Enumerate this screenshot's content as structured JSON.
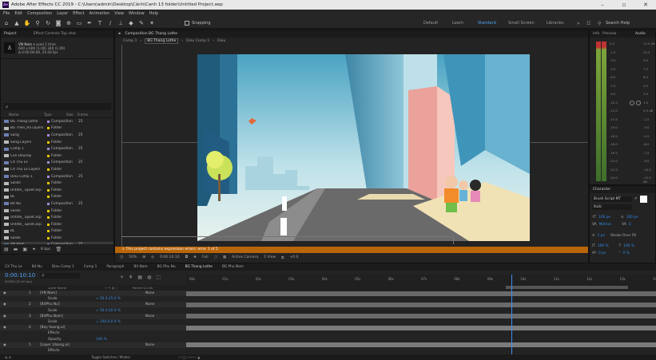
{
  "title_bar": {
    "app_logo": "Ae",
    "title": "Adobe After Effects CC 2019 - C:\\Users\\admin\\Desktop\\Cảnh\\Canh 13 folder\\Untitled Project.aep"
  },
  "menu": [
    "File",
    "Edit",
    "Composition",
    "Layer",
    "Effect",
    "Animation",
    "View",
    "Window",
    "Help"
  ],
  "toolbar": {
    "snapping": "Snapping",
    "workspaces": [
      "Default",
      "Learn",
      "Standard",
      "Small Screen",
      "Libraries"
    ],
    "active_workspace": "Standard",
    "search_placeholder": "Search Help"
  },
  "project_panel": {
    "tab": "Project",
    "tab2": "Effect Controls Top shot",
    "selected_item": "VN Nam",
    "selected_info": "used 1 time",
    "selected_size": "600 x 600 (1.00) 340 (1.00)",
    "selected_dur": "Δ 0:00:00:00, 25.00 fps",
    "search_placeholder": "ρ",
    "columns": [
      "Name",
      "Type",
      "Size",
      "Frame"
    ],
    "items": [
      {
        "name": "BG Thang Lothe",
        "type": "Composition",
        "rate": "25",
        "color": "#a58bd6",
        "icon": "comp"
      },
      {
        "name": "BG Then_Ra Layers",
        "type": "Folder",
        "rate": "",
        "color": "#e6c500",
        "icon": "folder"
      },
      {
        "name": "Song",
        "type": "Composition",
        "rate": "25",
        "color": "#a58bd6",
        "icon": "comp"
      },
      {
        "name": "Song Layers",
        "type": "Folder",
        "rate": "",
        "color": "#e6c500",
        "icon": "folder"
      },
      {
        "name": "Comp 1",
        "type": "Composition",
        "rate": "25",
        "color": "#a58bd6",
        "icon": "comp"
      },
      {
        "name": "Con Daunay",
        "type": "Folder",
        "rate": "",
        "color": "#e6c500",
        "icon": "folder"
      },
      {
        "name": "CX Thu Le",
        "type": "Composition",
        "rate": "25",
        "color": "#a58bd6",
        "icon": "comp"
      },
      {
        "name": "CX Thu Le Layers",
        "type": "Folder",
        "rate": "",
        "color": "#e6c500",
        "icon": "folder"
      },
      {
        "name": "Dieu Comp 1",
        "type": "Composition",
        "rate": "25",
        "color": "#a58bd6",
        "icon": "comp"
      },
      {
        "name": "Solids",
        "type": "Folder",
        "rate": "",
        "color": "#e6c500",
        "icon": "folder"
      },
      {
        "name": "Untitle_ upset.acp",
        "type": "Folder",
        "rate": "",
        "color": "#e6c500",
        "icon": "folder"
      },
      {
        "name": "BL",
        "type": "Folder",
        "rate": "",
        "color": "#e6c500",
        "icon": "folder"
      },
      {
        "name": "Bit Nu",
        "type": "Composition",
        "rate": "25",
        "color": "#a58bd6",
        "icon": "comp"
      },
      {
        "name": "Solids",
        "type": "Folder",
        "rate": "",
        "color": "#e6c500",
        "icon": "folder"
      },
      {
        "name": "Untitle_ upset.acp",
        "type": "Folder",
        "rate": "",
        "color": "#e6c500",
        "icon": "folder"
      },
      {
        "name": "Untitle_ upset.acp",
        "type": "Folder",
        "rate": "",
        "color": "#e6c500",
        "icon": "folder"
      },
      {
        "name": "BL",
        "type": "Folder",
        "rate": "",
        "color": "#e6c500",
        "icon": "folder"
      },
      {
        "name": "Solids",
        "type": "Folder",
        "rate": "",
        "color": "#e6c500",
        "icon": "folder"
      },
      {
        "name": "VN Nam",
        "type": "Composition",
        "rate": "25",
        "color": "#a58bd6",
        "icon": "comp"
      }
    ],
    "bpc": "8 bpc"
  },
  "composition": {
    "tab": "Composition BG Thang Lothe",
    "tabs": [
      "Comp 1",
      "BG Thang Lothe",
      "Dieu Comp 1",
      "Dieu"
    ],
    "active_tab": "BG Thang Lothe",
    "warning": "This project contains expression errors: error 1 of 5",
    "zoom": "50%",
    "timecode": "0:00:10:10",
    "resolution": "Full",
    "camera": "Active Camera",
    "view": "1 View",
    "offset": "+0.0"
  },
  "right_panel": {
    "tabs": [
      "Info",
      "Preview",
      "Audio"
    ],
    "active_tab": "Audio",
    "db_ticks_left": [
      "0.0",
      "-1.5",
      "-3.0",
      "-4.5",
      "-6.0",
      "-7.5",
      "-9.0",
      "-10.5",
      "-12.0",
      "-13.5",
      "-15.0",
      "-16.5",
      "-18.0",
      "-19.5",
      "-21.0",
      "-22.5",
      "-24.0"
    ],
    "db_ticks_right": [
      "12.0 dB",
      "10.5",
      "9.0",
      "7.5",
      "6.0",
      "4.5",
      "3.0",
      "1.5",
      "0.0 dB",
      "-1.5",
      "-3.0",
      "-4.5",
      "-6.0",
      "-7.5",
      "-9.0",
      "-10.5",
      "-12.0 dB"
    ],
    "character": {
      "tab": "Character",
      "font": "Brush Script MT",
      "style": "Italic",
      "size": "100 px",
      "leading": "100 px",
      "kerning": "Metrics",
      "tracking": "0",
      "stroke_width": "1 px",
      "stroke_mode": "Stroke Over Fill",
      "vscale": "100 %",
      "hscale": "100 %",
      "baseline": "0 px",
      "tsume": "0 %"
    }
  },
  "timeline": {
    "tabs": [
      "CX Thu Le",
      "Bit Nu",
      "Dieu Comp 1",
      "Comp 1",
      "Paragraph",
      "Bit Nam",
      "BG Phu Nu",
      "BG Thang Lothe",
      "BG Phu Nam"
    ],
    "active_tab": "BG Thang Lothe",
    "timecode": "0:00:10:10",
    "timecode_sub": "00260 (25.00 fps)",
    "search_placeholder": "ρ",
    "ruler": [
      "00s",
      "01s",
      "02s",
      "03s",
      "04s",
      "05s",
      "06s",
      "07s",
      "08s",
      "09s",
      "10s",
      "11s",
      "12s",
      "13s",
      "14s"
    ],
    "layers": [
      {
        "num": "1",
        "name": "[VN Nam]",
        "parent": "None",
        "color": "#8a8a8a",
        "bar_start": 0,
        "bar_end": 1,
        "kind": "layer"
      },
      {
        "num": "",
        "name": "Scale",
        "parent": "",
        "value": "∞ 50.0,25.0 %",
        "kind": "prop"
      },
      {
        "num": "2",
        "name": "[BitPhu Nu]",
        "parent": "None",
        "color": "#8a8a8a",
        "bar_start": 0,
        "bar_end": 1,
        "kind": "layer"
      },
      {
        "num": "",
        "name": "Scale",
        "parent": "",
        "value": "∞ 50.0,50.0 %",
        "kind": "prop"
      },
      {
        "num": "3",
        "name": "[BitPhu Nam]",
        "parent": "None",
        "color": "#8a8a8a",
        "bar_start": 0,
        "bar_end": 1,
        "kind": "layer"
      },
      {
        "num": "",
        "name": "Scale",
        "parent": "",
        "value": "∞ 100.0,0.0 %",
        "kind": "prop"
      },
      {
        "num": "4",
        "name": "[Bay Vuong.ai]",
        "parent": "",
        "color": "#b8b8b8",
        "bar_start": 0,
        "bar_end": 1,
        "kind": "layer"
      },
      {
        "num": "",
        "name": "Effects",
        "parent": "",
        "kind": "group"
      },
      {
        "num": "",
        "name": "Opacity",
        "parent": "",
        "value": "100 %",
        "kind": "prop"
      },
      {
        "num": "5",
        "name": "[Layer 1/bong.ai]",
        "parent": "None",
        "color": "#b8b8b8",
        "bar_start": 0,
        "bar_end": 1,
        "kind": "layer"
      },
      {
        "num": "",
        "name": "Effects",
        "parent": "",
        "kind": "group"
      }
    ],
    "col_labels": [
      "Layer Name",
      "Parent & Link"
    ],
    "footer": "Toggle Switches / Modes",
    "playhead_fraction": 0.693,
    "work_start_fraction": 0.68
  }
}
